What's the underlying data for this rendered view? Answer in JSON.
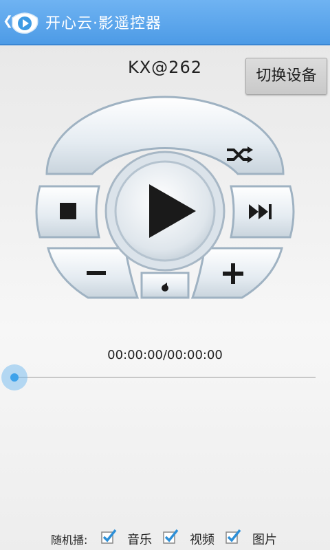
{
  "app": {
    "title": "开心云·影遥控器"
  },
  "device": {
    "name": "KX@262"
  },
  "actions": {
    "switch_device": "切换设备"
  },
  "remote": {
    "buttons": [
      "shuffle",
      "stop",
      "play",
      "next",
      "volume-down",
      "volume-up",
      "mute"
    ]
  },
  "playback": {
    "time": "00:00:00/00:00:00",
    "progress": 0
  },
  "random_play": {
    "label": "随机播:",
    "options": [
      {
        "label": "音乐",
        "checked": true
      },
      {
        "label": "视频",
        "checked": true
      },
      {
        "label": "图片",
        "checked": true
      }
    ]
  },
  "colors": {
    "action_bar": "#5fa9ee",
    "accent": "#3ea2ea",
    "check": "#2d8fd7"
  }
}
